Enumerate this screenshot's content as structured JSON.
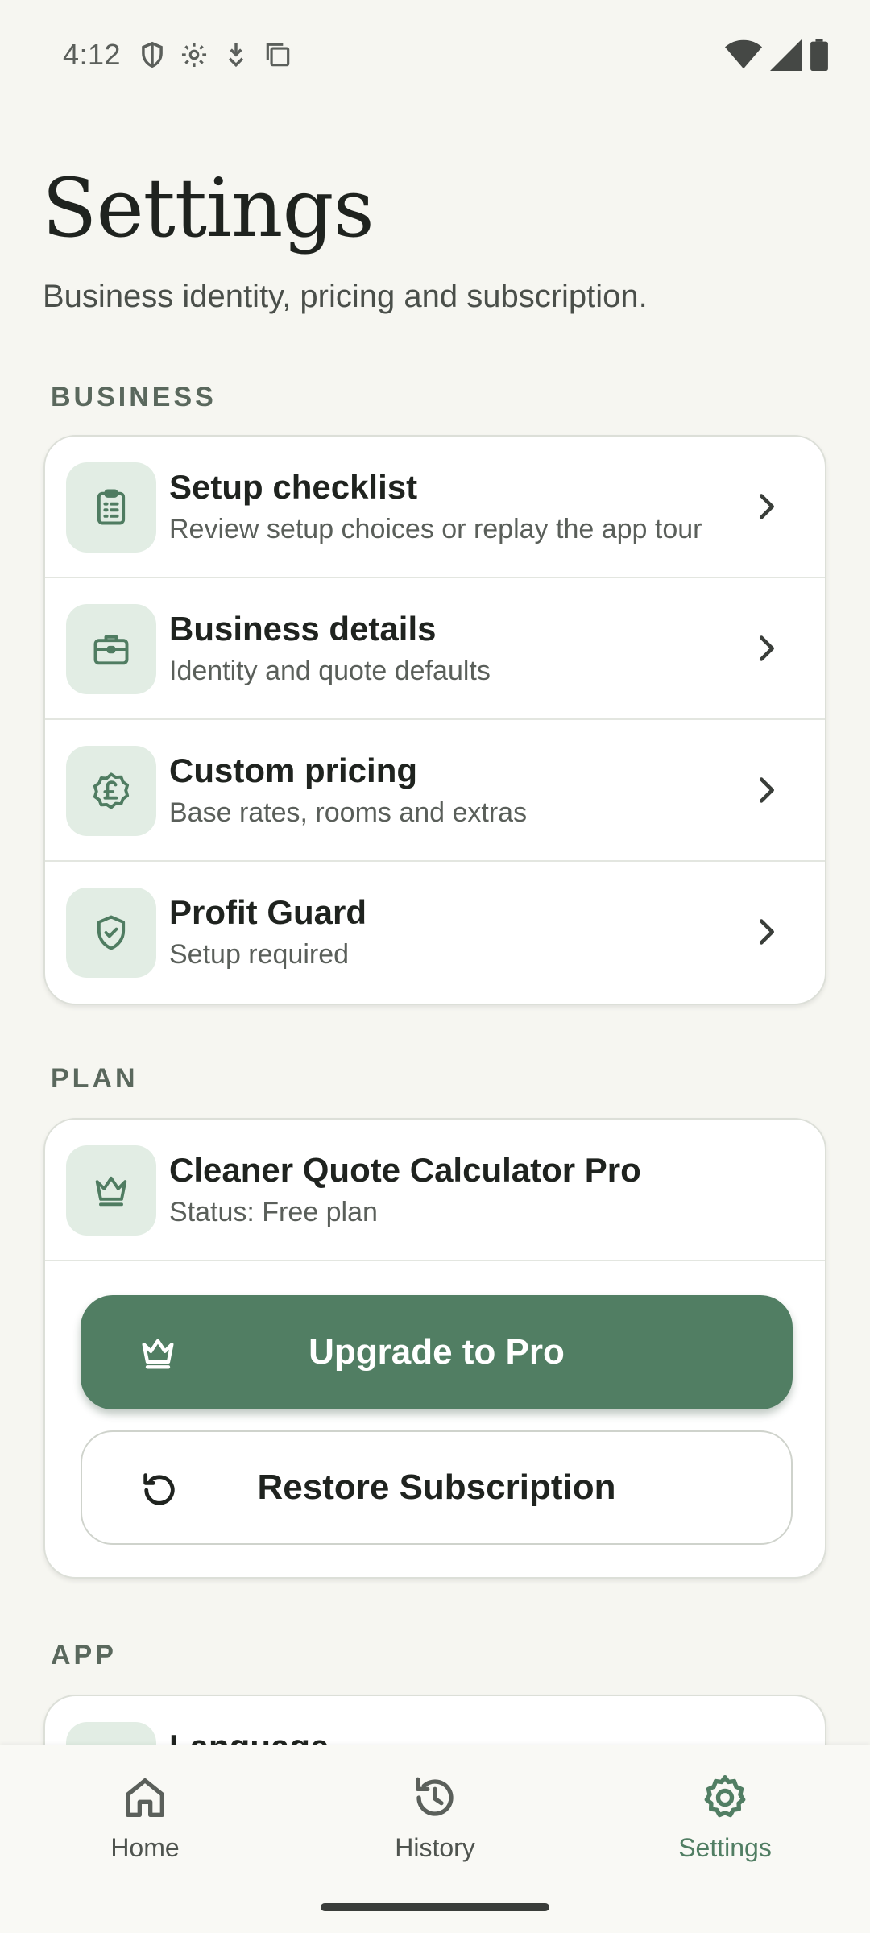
{
  "status_bar": {
    "time": "4:12",
    "left_icons": [
      "shield-icon",
      "gear-icon",
      "download-icon",
      "copy-icon"
    ],
    "right_icons": [
      "wifi-icon",
      "signal-icon",
      "battery-icon"
    ]
  },
  "header": {
    "title": "Settings",
    "subtitle": "Business identity, pricing and subscription."
  },
  "sections": {
    "business": {
      "label": "BUSINESS",
      "items": [
        {
          "title": "Setup checklist",
          "subtitle": "Review setup choices or replay the app tour",
          "icon": "clipboard-list-icon"
        },
        {
          "title": "Business details",
          "subtitle": "Identity and quote defaults",
          "icon": "briefcase-icon"
        },
        {
          "title": "Custom pricing",
          "subtitle": "Base rates, rooms and extras",
          "icon": "pound-badge-icon"
        },
        {
          "title": "Profit Guard",
          "subtitle": "Setup required",
          "icon": "shield-check-icon"
        }
      ]
    },
    "plan": {
      "label": "PLAN",
      "product_title": "Cleaner Quote Calculator Pro",
      "status": "Status: Free plan",
      "upgrade_label": "Upgrade to Pro",
      "restore_label": "Restore Subscription"
    },
    "app": {
      "label": "APP",
      "first_item_title": "Language"
    }
  },
  "bottom_nav": {
    "items": [
      {
        "label": "Home",
        "icon": "home-icon"
      },
      {
        "label": "History",
        "icon": "history-icon"
      },
      {
        "label": "Settings",
        "icon": "gear-icon",
        "active": true
      }
    ]
  },
  "colors": {
    "accent": "#517e63",
    "icon_tile": "#e2ede4",
    "background": "#f6f6f1",
    "nav_inactive": "#5b605b"
  }
}
